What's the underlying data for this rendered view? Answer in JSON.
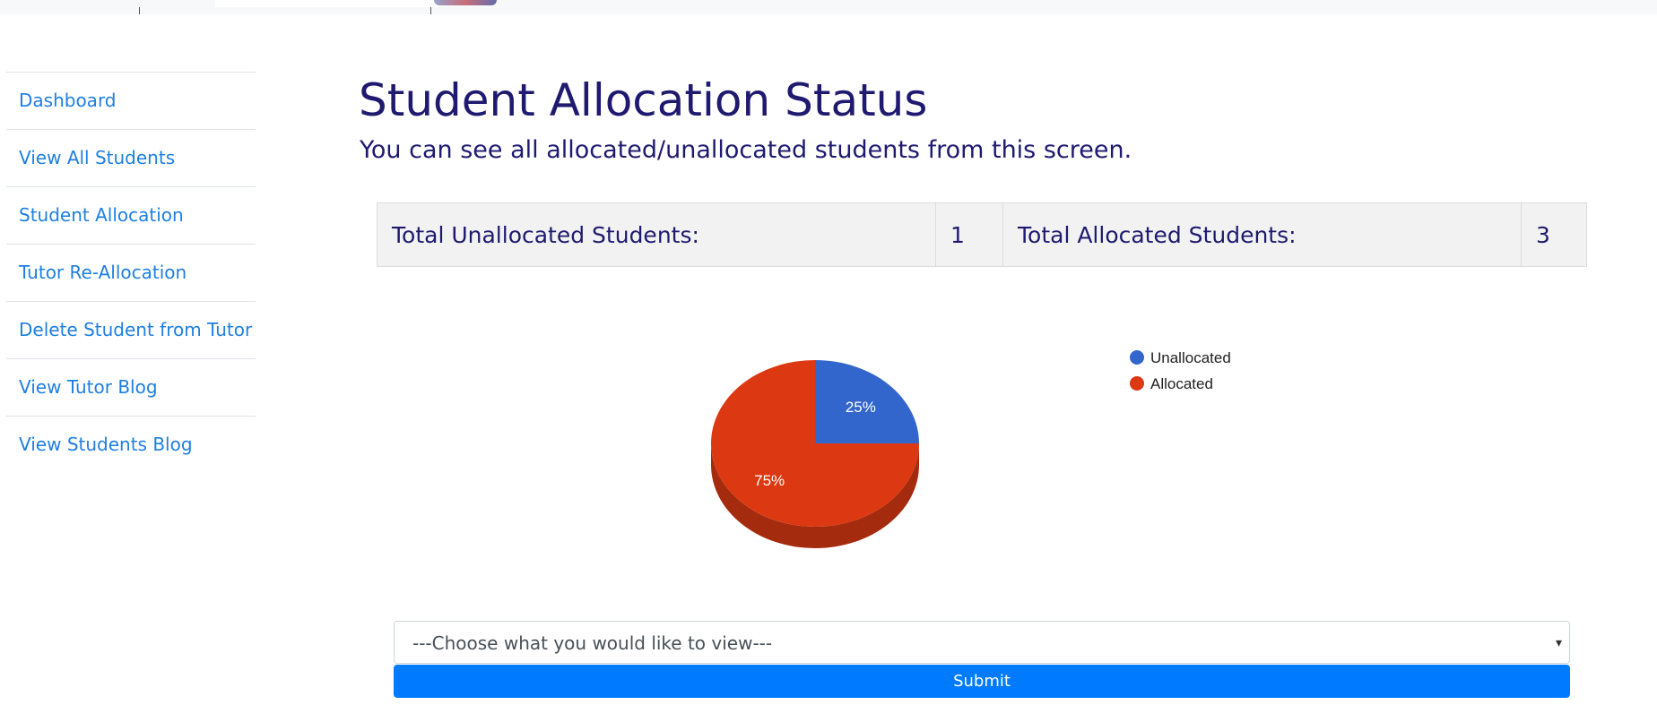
{
  "sidebar": {
    "items": [
      {
        "label": "Dashboard"
      },
      {
        "label": "View All Students"
      },
      {
        "label": "Student Allocation"
      },
      {
        "label": "Tutor Re-Allocation"
      },
      {
        "label": "Delete Student from Tutor"
      },
      {
        "label": "View Tutor Blog"
      },
      {
        "label": "View Students Blog"
      }
    ]
  },
  "main": {
    "title": "Student Allocation Status",
    "subtitle": "You can see all allocated/unallocated students from this screen.",
    "stats": {
      "unallocated_label": "Total Unallocated Students:",
      "unallocated_value": "1",
      "allocated_label": "Total Allocated Students:",
      "allocated_value": "3"
    },
    "view_select": {
      "selected": "---Choose what you would like to view---"
    },
    "submit_label": "Submit"
  },
  "colors": {
    "unallocated": "#3366cc",
    "allocated": "#dc3912",
    "allocated_side": "#a52b0e",
    "link": "#1e7fe0",
    "heading": "#1f1a6f",
    "button": "#007bff"
  },
  "chart_data": {
    "type": "pie",
    "categories": [
      "Unallocated",
      "Allocated"
    ],
    "values": [
      1,
      3
    ],
    "labels": [
      "25%",
      "75%"
    ],
    "legend": "right",
    "style": "3d"
  }
}
